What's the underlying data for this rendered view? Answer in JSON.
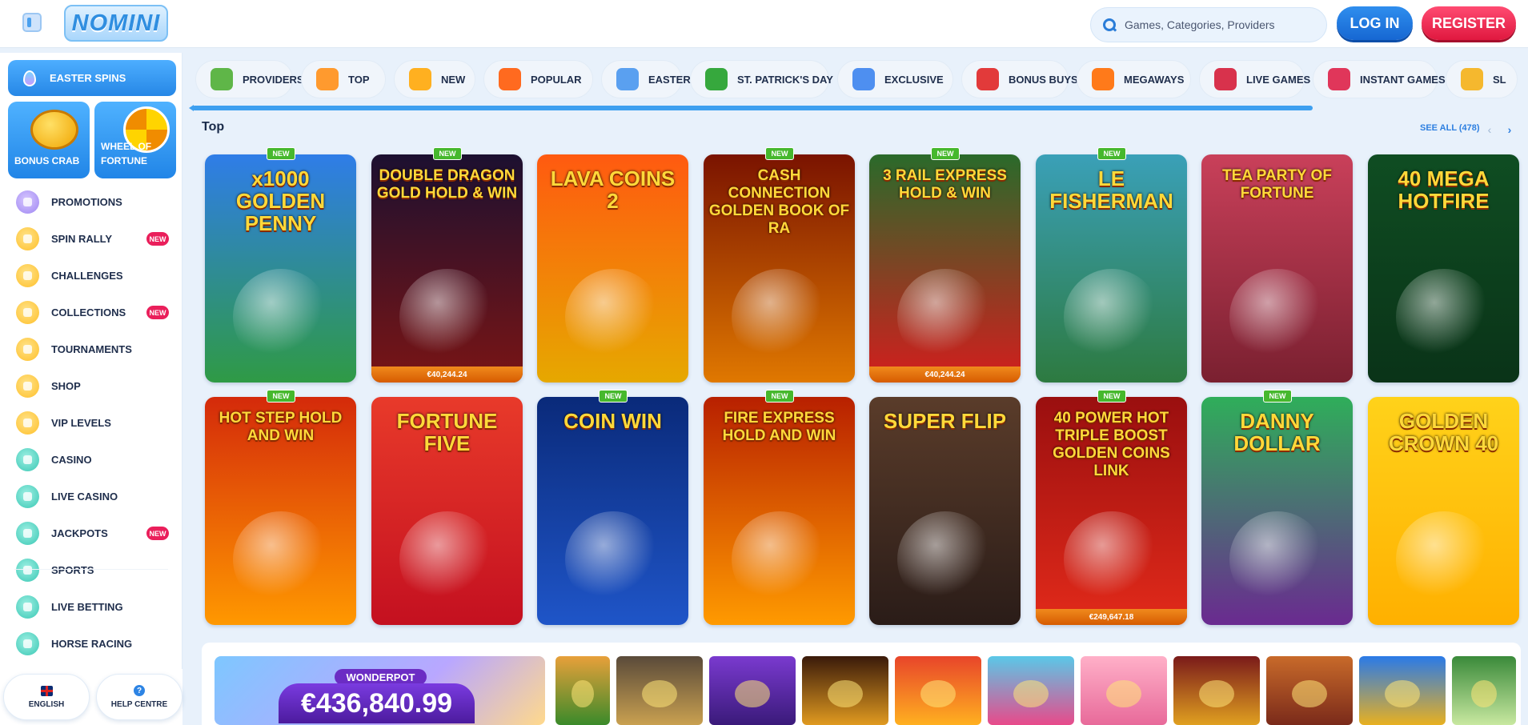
{
  "header": {
    "logo": "NOMINI",
    "search_placeholder": "Games, Categories, Providers",
    "login": "LOG IN",
    "register": "REGISTER"
  },
  "sidebar": {
    "easter": "EASTER SPINS",
    "promo_tiles": [
      {
        "label": "BONUS CRAB"
      },
      {
        "label": "WHEEL OF FORTUNE"
      }
    ],
    "items": [
      {
        "label": "PROMOTIONS",
        "icon": "promotions-icon",
        "color": "purple",
        "new": false
      },
      {
        "label": "SPIN RALLY",
        "icon": "spin-rally-icon",
        "color": "yellow",
        "new": true
      },
      {
        "label": "CHALLENGES",
        "icon": "challenges-icon",
        "color": "yellow",
        "new": false
      },
      {
        "label": "COLLECTIONS",
        "icon": "collections-icon",
        "color": "yellow",
        "new": true
      },
      {
        "label": "TOURNAMENTS",
        "icon": "tournaments-icon",
        "color": "yellow",
        "new": false
      },
      {
        "label": "SHOP",
        "icon": "shop-icon",
        "color": "yellow",
        "new": false
      },
      {
        "label": "VIP LEVELS",
        "icon": "vip-icon",
        "color": "yellow",
        "new": false
      },
      {
        "label": "CASINO",
        "icon": "casino-icon",
        "color": "teal",
        "new": false
      },
      {
        "label": "LIVE CASINO",
        "icon": "live-casino-icon",
        "color": "teal",
        "new": false
      },
      {
        "label": "JACKPOTS",
        "icon": "jackpots-icon",
        "color": "teal",
        "new": true
      },
      {
        "label": "SPORTS",
        "icon": "sports-icon",
        "color": "teal",
        "new": false
      },
      {
        "label": "LIVE BETTING",
        "icon": "live-betting-icon",
        "color": "teal",
        "new": false
      },
      {
        "label": "HORSE RACING",
        "icon": "horse-racing-icon",
        "color": "teal",
        "new": false
      }
    ],
    "new_badge": "NEW",
    "language": "ENGLISH",
    "help": "HELP CENTRE",
    "help_glyph": "?"
  },
  "categories": [
    {
      "label": "PROVIDERS",
      "color": "#5fb648"
    },
    {
      "label": "TOP",
      "color": "#ff9a2e"
    },
    {
      "label": "NEW",
      "color": "#ffb020"
    },
    {
      "label": "POPULAR",
      "color": "#ff6a1f"
    },
    {
      "label": "EASTER",
      "color": "#5aa0f0"
    },
    {
      "label": "ST. PATRICK'S DAY",
      "color": "#36a83d"
    },
    {
      "label": "EXCLUSIVE",
      "color": "#4e8ff0"
    },
    {
      "label": "BONUS BUYS",
      "color": "#e23a3a"
    },
    {
      "label": "MEGAWAYS",
      "color": "#ff7a1a"
    },
    {
      "label": "LIVE GAMES",
      "color": "#d8324c"
    },
    {
      "label": "INSTANT GAMES",
      "color": "#e0365a"
    },
    {
      "label": "SL",
      "color": "#f5b82e"
    }
  ],
  "section": {
    "title": "Top",
    "see_all": "SEE ALL (478)",
    "prev": "‹",
    "next": "›"
  },
  "games": [
    {
      "title": "x1000 GOLDEN PENNY",
      "new": true,
      "jackpot": "",
      "bg": "linear-gradient(#2f7de8,#2f9a45)"
    },
    {
      "title": "DOUBLE DRAGON GOLD HOLD & WIN",
      "new": true,
      "jackpot": "€40,244.24",
      "bg": "linear-gradient(#1c1030,#7a1515)"
    },
    {
      "title": "LAVA COINS 2",
      "new": false,
      "jackpot": "",
      "bg": "linear-gradient(#ff5a10,#e6a800)"
    },
    {
      "title": "CASH CONNECTION GOLDEN BOOK OF RA",
      "new": true,
      "jackpot": "",
      "bg": "linear-gradient(#7a1300,#e07800)"
    },
    {
      "title": "3 RAIL EXPRESS HOLD & WIN",
      "new": true,
      "jackpot": "€40,244.24",
      "bg": "linear-gradient(#2a6a2a,#d41d1d)"
    },
    {
      "title": "LE FISHERMAN",
      "new": true,
      "jackpot": "",
      "bg": "linear-gradient(#3aa0b8,#2d7a40)"
    },
    {
      "title": "TEA PARTY OF FORTUNE",
      "new": false,
      "jackpot": "",
      "bg": "linear-gradient(#c9405a,#7a2030)"
    },
    {
      "title": "40 MEGA HOTFIRE",
      "new": false,
      "jackpot": "",
      "bg": "linear-gradient(#0f4d22,#0a3318)"
    },
    {
      "title": "HOT STEP HOLD AND WIN",
      "new": true,
      "jackpot": "",
      "bg": "linear-gradient(#d42a0a,#ff9800)"
    },
    {
      "title": "FORTUNE FIVE",
      "new": false,
      "jackpot": "",
      "bg": "linear-gradient(#e83a2a,#c41020)"
    },
    {
      "title": "COIN WIN",
      "new": true,
      "jackpot": "",
      "bg": "linear-gradient(#0a2a7a,#1f55c8)"
    },
    {
      "title": "FIRE EXPRESS HOLD AND WIN",
      "new": true,
      "jackpot": "",
      "bg": "linear-gradient(#b82000,#ff9a00)"
    },
    {
      "title": "SUPER FLIP",
      "new": false,
      "jackpot": "",
      "bg": "linear-gradient(#5a3c2a,#2a1c18)"
    },
    {
      "title": "40 POWER HOT TRIPLE BOOST GOLDEN COINS LINK",
      "new": true,
      "jackpot": "€249,647.18",
      "bg": "linear-gradient(#9a0f0f,#e22a1a)"
    },
    {
      "title": "DANNY DOLLAR",
      "new": true,
      "jackpot": "",
      "bg": "linear-gradient(#2fae5a,#6a2a90)"
    },
    {
      "title": "GOLDEN CROWN 40",
      "new": false,
      "jackpot": "",
      "bg": "linear-gradient(#ffd21a,#ffb000)"
    }
  ],
  "wonderpot": {
    "label": "WONDERPOT",
    "amount": "€436,840.99"
  },
  "thumbs": [
    {
      "bg": "linear-gradient(#e8a03a,#3a8a2a)"
    },
    {
      "bg": "linear-gradient(#5a4a3a,#c9a050)"
    },
    {
      "bg": "linear-gradient(#7a3acf,#3a1a7a)"
    },
    {
      "bg": "linear-gradient(#3a1a0a,#e09a20)"
    },
    {
      "bg": "linear-gradient(#e8452a,#ffb020)"
    },
    {
      "bg": "linear-gradient(#5ac8e8,#e84a8a)"
    },
    {
      "bg": "linear-gradient(#ffb0c8,#e86a9a)"
    },
    {
      "bg": "linear-gradient(#7a1a1a,#e0a020)"
    },
    {
      "bg": "linear-gradient(#c86a2a,#7a2a1a)"
    },
    {
      "bg": "linear-gradient(#2a7ae8,#e8b020)"
    },
    {
      "bg": "linear-gradient(#3a8a3a,#c8e8a0)"
    }
  ]
}
